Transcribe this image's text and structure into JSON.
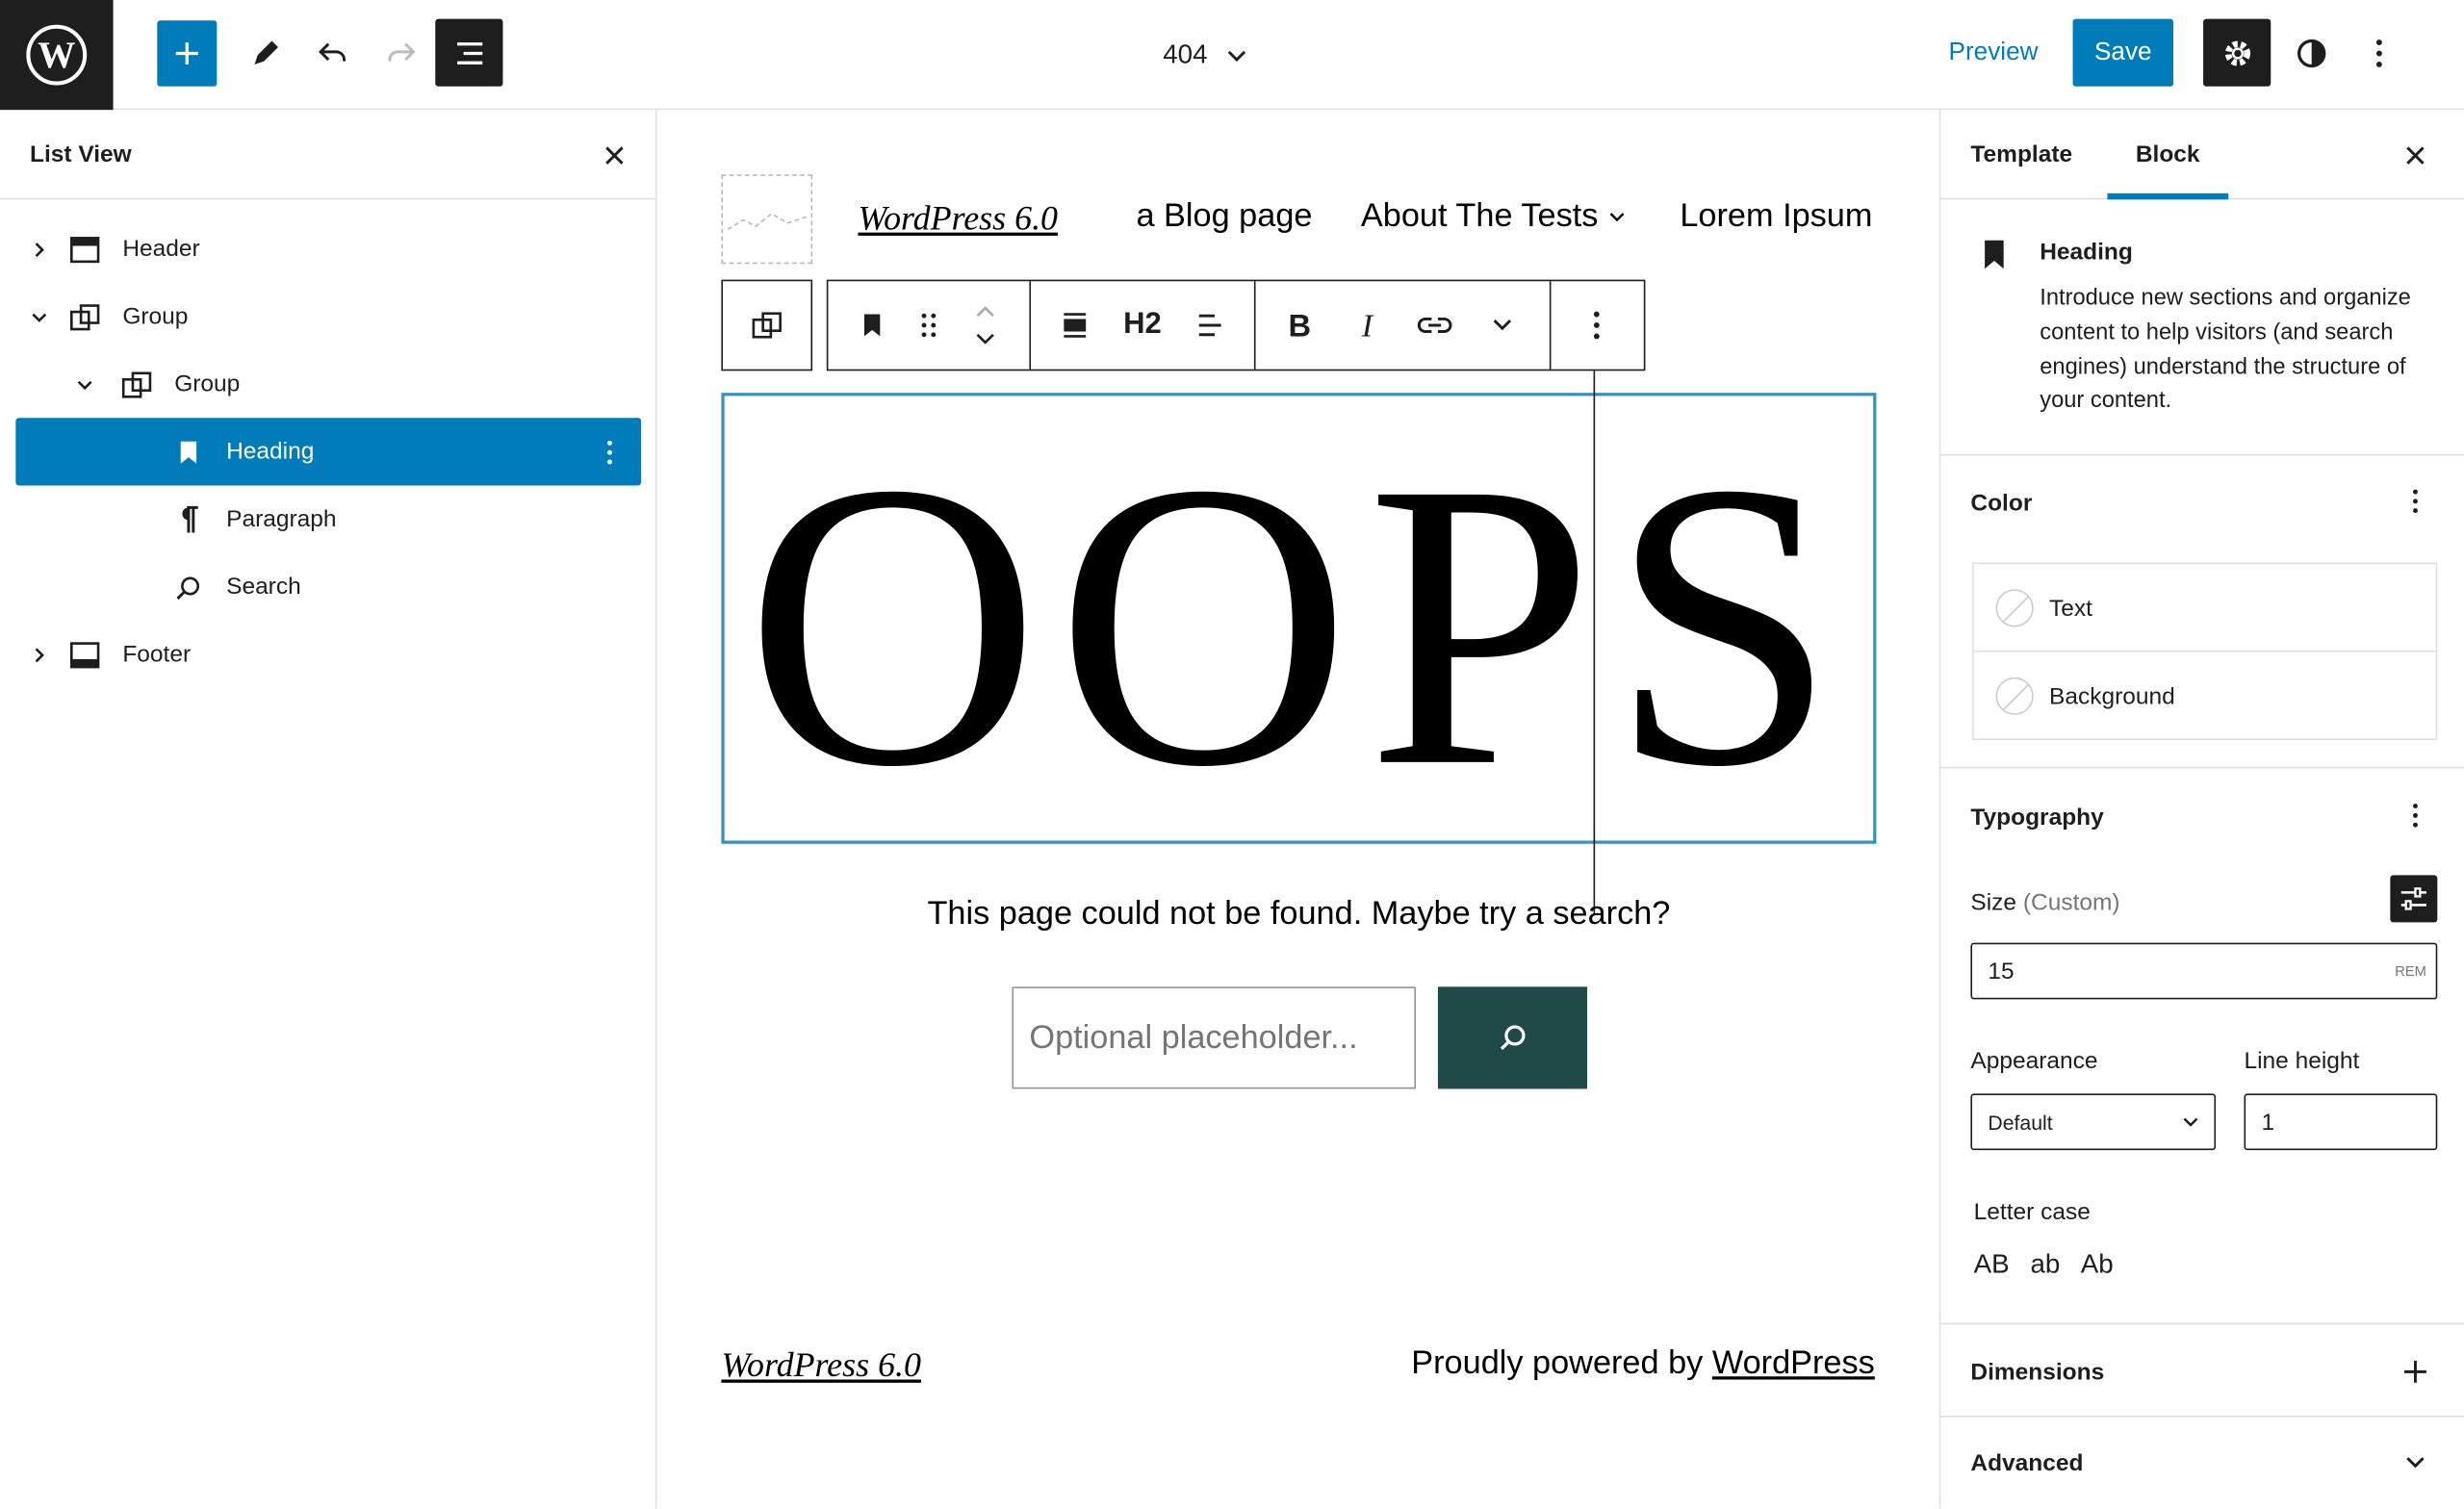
{
  "header": {
    "doc_title": "404",
    "preview_label": "Preview",
    "save_label": "Save"
  },
  "list_view": {
    "title": "List View",
    "items": [
      {
        "label": "Header"
      },
      {
        "label": "Group"
      },
      {
        "label": "Group"
      },
      {
        "label": "Heading"
      },
      {
        "label": "Paragraph"
      },
      {
        "label": "Search"
      },
      {
        "label": "Footer"
      }
    ]
  },
  "canvas": {
    "site_title": "WordPress 6.0",
    "nav": [
      {
        "label": "a Blog page"
      },
      {
        "label": "About The Tests"
      },
      {
        "label": "Lorem Ipsum"
      }
    ],
    "toolbar": {
      "heading_level": "H2"
    },
    "heading": "OOPS",
    "paragraph": "This page could not be found. Maybe try a search?",
    "search_placeholder": "Optional placeholder...",
    "footer_title": "WordPress 6.0",
    "footer_powered_prefix": "Proudly powered by ",
    "footer_powered_link": "WordPress"
  },
  "sidebar": {
    "tabs": [
      {
        "label": "Template"
      },
      {
        "label": "Block"
      }
    ],
    "active_tab": "Block",
    "block_card": {
      "title": "Heading",
      "description": "Introduce new sections and organize content to help visitors (and search engines) understand the structure of your content."
    },
    "color": {
      "title": "Color",
      "items": [
        {
          "label": "Text"
        },
        {
          "label": "Background"
        }
      ]
    },
    "typography": {
      "title": "Typography",
      "size_label": "Size",
      "size_hint": "(Custom)",
      "size_value": "15",
      "size_unit": "REM",
      "appearance_label": "Appearance",
      "appearance_value": "Default",
      "line_height_label": "Line height",
      "line_height_value": "1",
      "letter_case_label": "Letter case",
      "letter_case_options": [
        "AB",
        "ab",
        "Ab"
      ]
    },
    "dimensions_title": "Dimensions",
    "advanced_title": "Advanced"
  },
  "colors": {
    "accent": "#007cba",
    "dark": "#1e1e1e",
    "search_button": "#1f4a48"
  }
}
